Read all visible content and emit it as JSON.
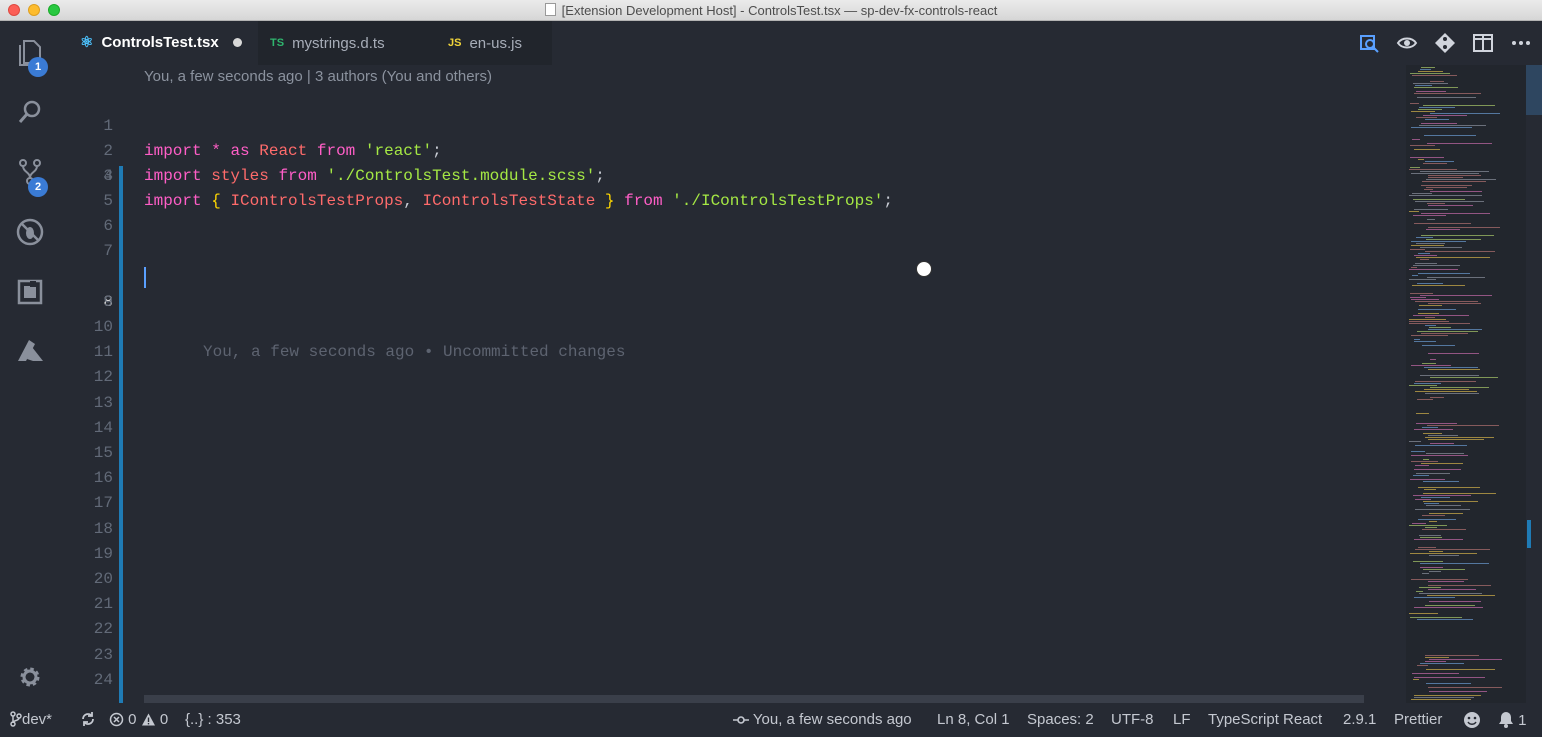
{
  "window": {
    "title": "[Extension Development Host] - ControlsTest.tsx — sp-dev-fx-controls-react"
  },
  "activity_bar": {
    "explorer_badge": "1",
    "scm_badge": "2",
    "items": [
      "explorer-icon",
      "search-icon",
      "source-control-icon",
      "debug-icon",
      "extensions-icon",
      "azure-icon",
      "settings-gear-icon"
    ]
  },
  "tabs": [
    {
      "label": "ControlsTest.tsx",
      "icon": "react-icon",
      "icon_text": "⚛",
      "active": true,
      "dirty": true
    },
    {
      "label": "mystrings.d.ts",
      "icon": "typescript-icon",
      "icon_text": "TS",
      "active": false
    },
    {
      "label": "en-us.js",
      "icon": "javascript-icon",
      "icon_text": "JS",
      "active": false
    }
  ],
  "editor": {
    "codelens": "You, a few seconds ago | 3 authors (You and others)",
    "active_line": 8,
    "blame_annotation": "You, a few seconds ago • Uncommitted changes",
    "line_numbers": [
      "1",
      "2",
      "3",
      "4",
      "5",
      "6",
      "7",
      "8",
      "9",
      "10",
      "11",
      "12",
      "13",
      "14",
      "15",
      "16",
      "17",
      "18",
      "19",
      "20",
      "21",
      "22",
      "23",
      "24"
    ],
    "lines": {
      "l1": {
        "kw_import": "import",
        "star": "*",
        "kw_as": "as",
        "name": "React",
        "kw_from": "from",
        "path": "'react'",
        "semi": ";"
      },
      "l2": {
        "kw_import": "import",
        "name": "styles",
        "kw_from": "from",
        "path": "'./ControlsTest.module.scss'",
        "semi": ";"
      },
      "l3": {
        "kw_import": "import",
        "open": "{",
        "type1": "IControlsTestProps",
        "comma": ",",
        "type2": "IControlsTestState",
        "close": "}",
        "kw_from": "from",
        "path": "'./IControlsTestProps'",
        "semi": ";"
      }
    }
  },
  "statusbar": {
    "branch": "dev*",
    "errors": "0",
    "warnings": "0",
    "symbols": "{..} : 353",
    "blame": "You, a few seconds ago",
    "position": "Ln 8, Col 1",
    "spaces": "Spaces: 2",
    "encoding": "UTF-8",
    "eol": "LF",
    "language": "TypeScript React",
    "ts_version": "2.9.1",
    "formatter": "Prettier",
    "notifications": "1"
  },
  "colors": {
    "keyword": "#ff5ec7",
    "type": "#ff6b6b",
    "string": "#a5e844",
    "bracket": "#ffd700",
    "accent": "#1f7bb5",
    "background": "#262a33"
  }
}
